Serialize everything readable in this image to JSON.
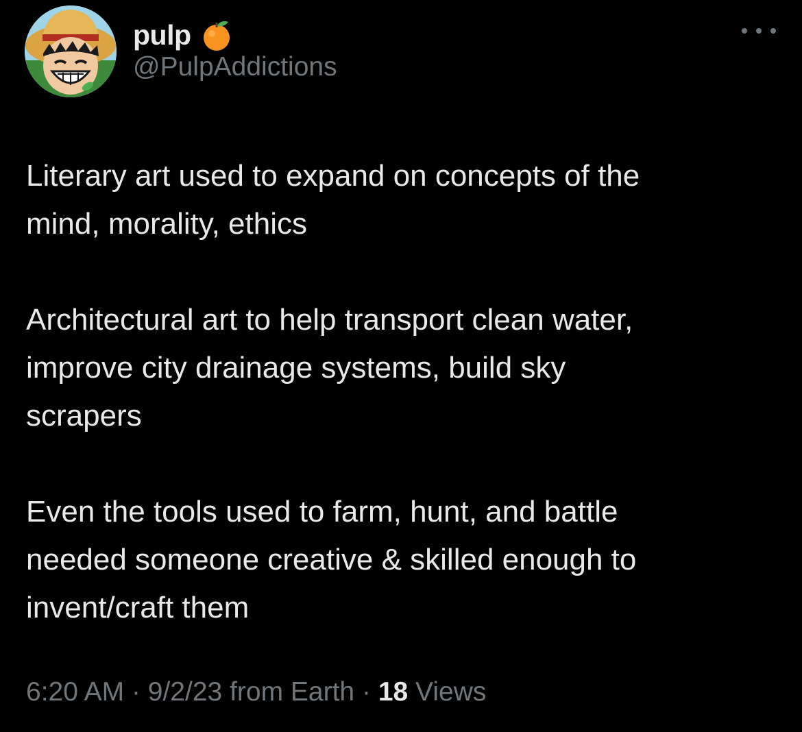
{
  "user": {
    "display_name": "pulp",
    "emoji": "orange-emoji",
    "handle": "@PulpAddictions",
    "avatar": "avatar-image"
  },
  "tweet": {
    "paragraphs": [
      "Literary art used to expand on concepts of the\nmind, morality, ethics",
      "Architectural art to help transport clean water,\nimprove city drainage systems, build sky\nscrapers",
      "Even the tools used to farm, hunt, and battle\nneeded someone creative & skilled enough to\ninvent/craft them"
    ],
    "time": "6:20 AM",
    "separator": "·",
    "date": "9/2/23",
    "source": "from Earth",
    "views_count": "18",
    "views_label": "Views"
  },
  "colors": {
    "background": "#000000",
    "text_primary": "#e7e9ea",
    "text_secondary": "#71767b"
  },
  "icons": {
    "more": "more-horizontal-icon"
  }
}
